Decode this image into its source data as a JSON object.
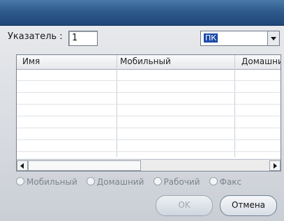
{
  "window": {
    "title": ""
  },
  "form": {
    "index_label": "Указатель :",
    "index_value": "1",
    "combo_value": "ПК"
  },
  "table": {
    "columns": [
      "Имя",
      "Мобильный",
      "Домашний"
    ],
    "rows": [
      [],
      [],
      [],
      [],
      [],
      [],
      [],
      []
    ]
  },
  "radios": {
    "options": [
      "Мобильный",
      "Домашний",
      "Рабочий",
      "Факс"
    ]
  },
  "buttons": {
    "ok": "OK",
    "cancel": "Отмена"
  },
  "colors": {
    "title_bar": "#2e5a8c",
    "selection": "#1a4aa8"
  }
}
